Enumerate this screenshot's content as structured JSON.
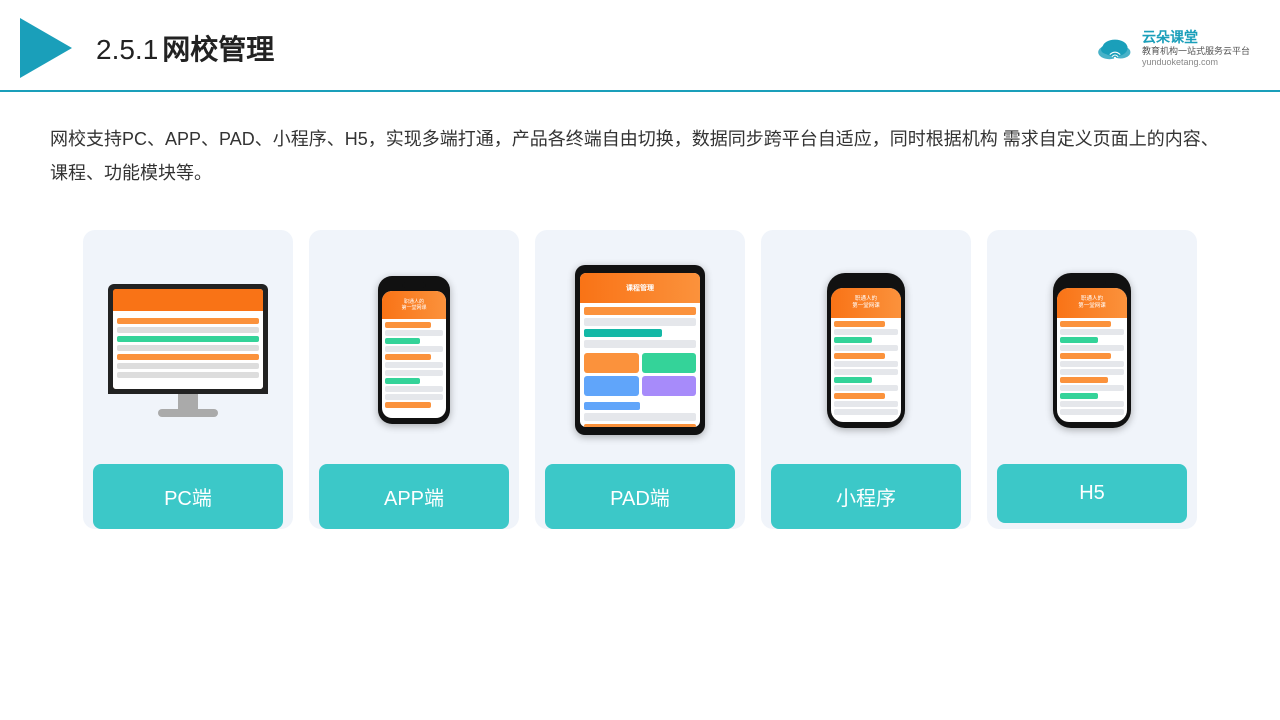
{
  "header": {
    "section": "2.5.1",
    "title": "网校管理",
    "brand_name": "云朵课堂",
    "brand_sub": "教育机构一站\n式服务云平台",
    "brand_url": "yunduoketang.com"
  },
  "description": "网校支持PC、APP、PAD、小程序、H5，实现多端打通，产品各终端自由切换，数据同步跨平台自适应，同时根据机构\n需求自定义页面上的内容、课程、功能模块等。",
  "cards": [
    {
      "id": "pc",
      "label": "PC端"
    },
    {
      "id": "app",
      "label": "APP端"
    },
    {
      "id": "pad",
      "label": "PAD端"
    },
    {
      "id": "miniprogram",
      "label": "小程序"
    },
    {
      "id": "h5",
      "label": "H5"
    }
  ],
  "colors": {
    "teal": "#3cc8c8",
    "header_border": "#1a9fba",
    "text_primary": "#333333",
    "brand_color": "#1a9fba"
  }
}
